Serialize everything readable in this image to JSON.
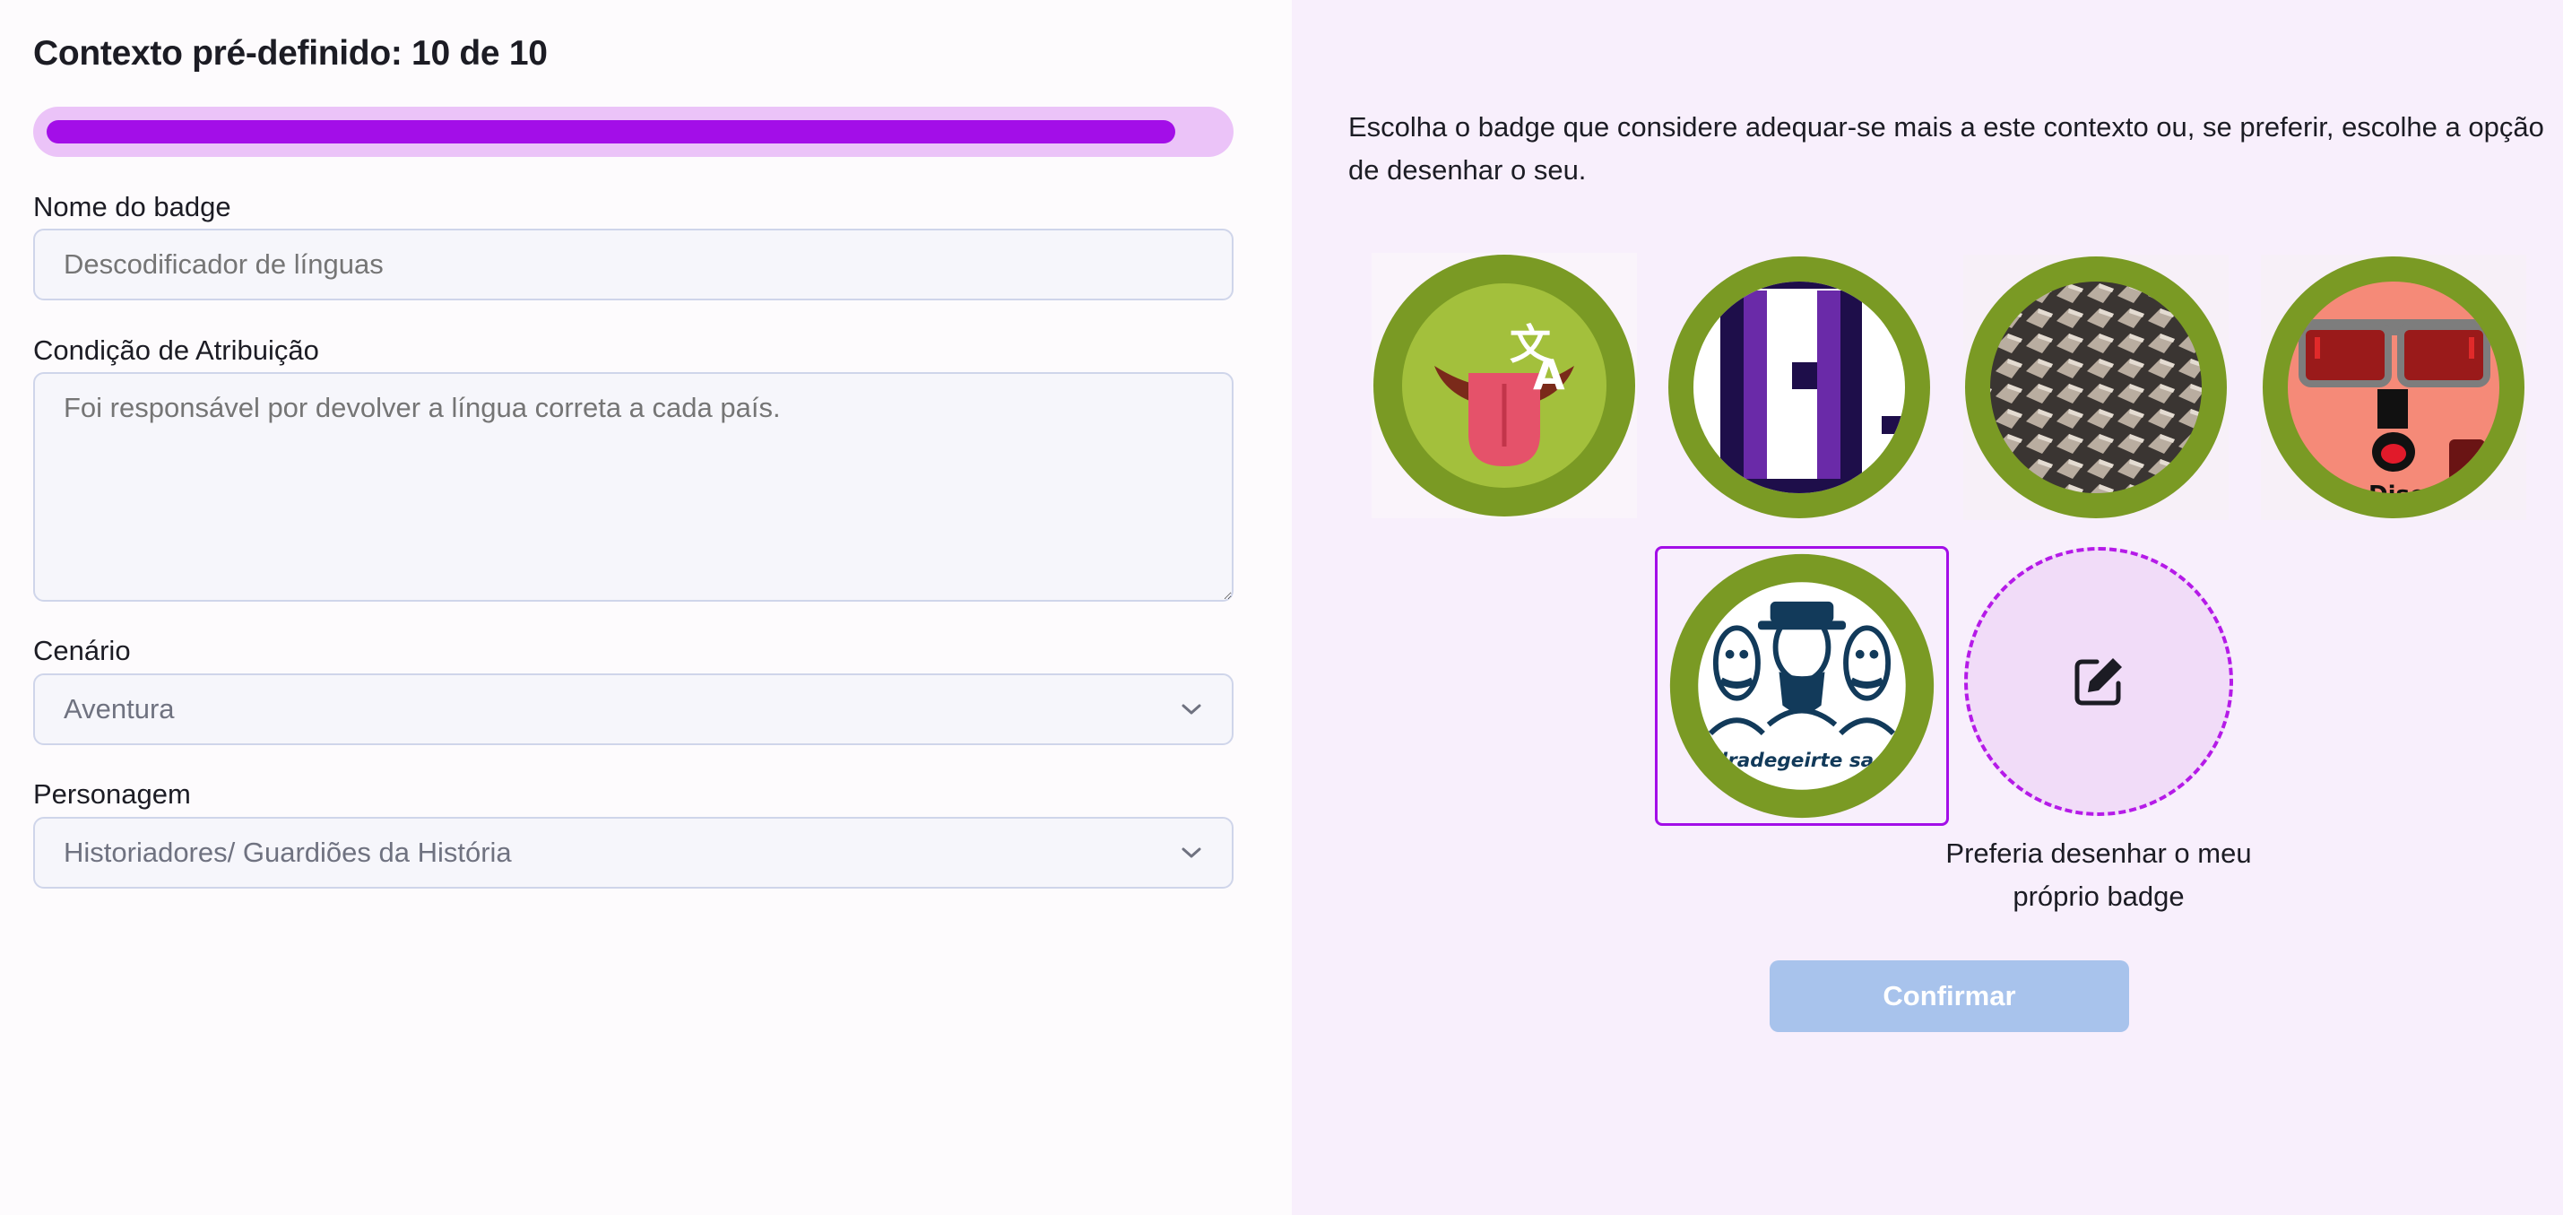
{
  "header": {
    "title": "Contexto pré-definido: 10 de 10",
    "progress_fraction": 1.0
  },
  "form": {
    "badge_name": {
      "label": "Nome do badge",
      "placeholder": "Descodificador de línguas"
    },
    "condition": {
      "label": "Condição de Atribuição",
      "placeholder": "Foi responsável por devolver a língua correta a cada país."
    },
    "scenario": {
      "label": "Cenário",
      "value": "Aventura"
    },
    "character": {
      "label": "Personagem",
      "value": "Historiadores/ Guardiões da História"
    }
  },
  "badge_picker": {
    "instructions": "Escolha o badge que considere adequar-se mais a este contexto ou, se preferir, escolhe a opção de desenhar o seu.",
    "options": [
      {
        "icon": "translate-tongue-icon"
      },
      {
        "icon": "purple-pattern-icon"
      },
      {
        "icon": "textured-tiles-icon"
      },
      {
        "icon": "cartoon-face-icon"
      },
      {
        "icon": "mustached-men-icon",
        "selected": true
      }
    ],
    "badge_caption_text": "The rodradegeirte sacodirica",
    "face_caption_text": "Disc",
    "draw_own_label": "Preferia desenhar o meu próprio badge",
    "draw_own_icon": "pencil-square-icon",
    "confirm_label": "Confirmar"
  },
  "colors": {
    "accent": "#a30ee8",
    "badge_ring": "#7a9a24",
    "confirm_disabled": "#a8c3ec",
    "right_panel_bg": "#f8effc"
  }
}
